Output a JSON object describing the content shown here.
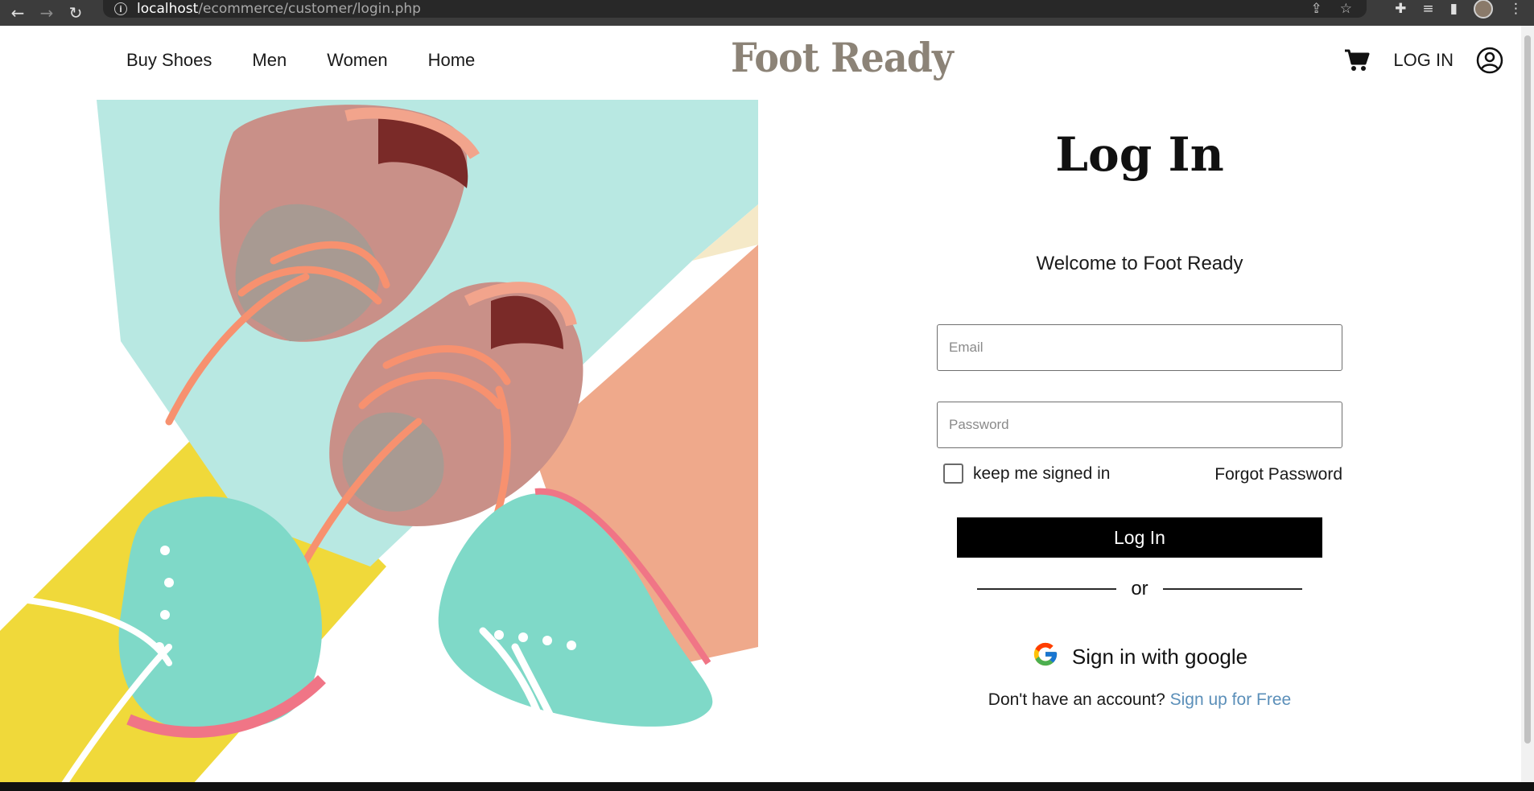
{
  "browser": {
    "url_host": "localhost",
    "url_path": "/ecommerce/customer/login.php",
    "back_icon": "arrow-left",
    "forward_icon": "arrow-right",
    "reload_icon": "reload"
  },
  "header": {
    "nav": [
      "Buy Shoes",
      "Men",
      "Women",
      "Home"
    ],
    "logo": "Foot Ready",
    "login_label": "LOG IN",
    "cart_icon": "shopping-cart",
    "user_icon": "user-circle",
    "logo_color": "#8c8377"
  },
  "login": {
    "title": "Log In",
    "welcome": "Welcome to Foot Ready",
    "email_placeholder": "Email",
    "password_placeholder": "Password",
    "remember_label": "keep me signed in",
    "forgot_label": "Forgot Password",
    "submit_label": "Log In",
    "divider_label": "or",
    "google_label": "Sign in with google",
    "signup_prompt": "Don't have an account?",
    "signup_link": "Sign up for Free",
    "link_color": "#5b8fb9"
  }
}
